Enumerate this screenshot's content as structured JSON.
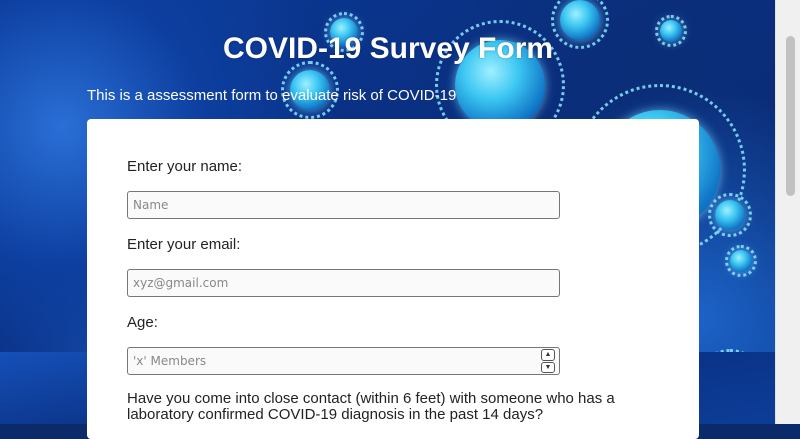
{
  "header": {
    "title": "COVID-19 Survey Form",
    "subtitle": "This is a assessment form to evaluate risk of COVID-19"
  },
  "form": {
    "name_label": "Enter your name:",
    "name_placeholder": "Name",
    "email_label": "Enter your email:",
    "email_placeholder": "xyz@gmail.com",
    "age_label": "Age:",
    "age_placeholder": "'x' Members",
    "contact_question": "Have you come into close contact (within 6 feet) with someone who has a laboratory confirmed COVID-19 diagnosis in the past 14 days?"
  },
  "colors": {
    "background_accent": "#0a2f82",
    "card": "#ffffff",
    "title_text": "#ffffff"
  },
  "icons": {
    "stepper_up": "chevron-up-icon",
    "stepper_down": "chevron-down-icon"
  }
}
